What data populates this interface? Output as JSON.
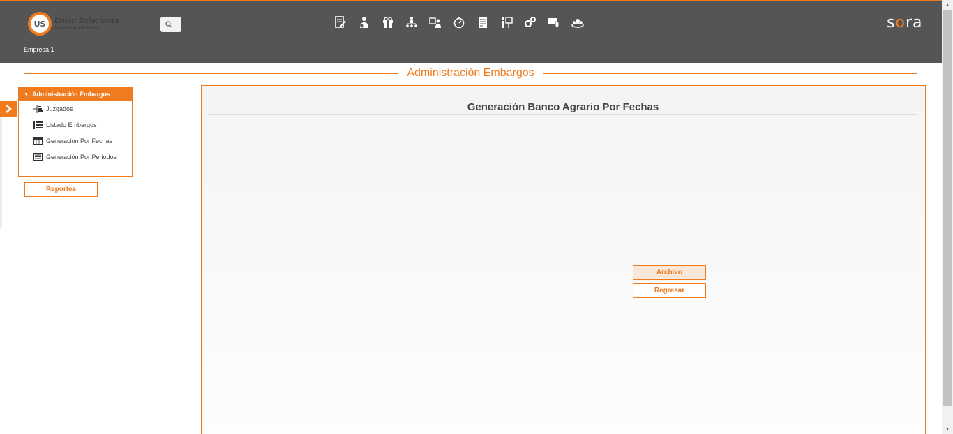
{
  "header": {
    "logo_line1": "Unión Soluciones",
    "logo_line2": "Sistemas de Información",
    "logo_mark": "US",
    "company": "Empresa 1",
    "brand_prefix": "s",
    "brand_o": "o",
    "brand_suffix": "ra",
    "top_icons": [
      "notes-edit-icon",
      "employee-money-icon",
      "gift-icon",
      "hierarchy-icon",
      "staff-exchange-icon",
      "stopwatch-icon",
      "document-list-icon",
      "training-presentation-icon",
      "gears-icon",
      "shield-badge-icon",
      "team-meeting-icon"
    ]
  },
  "page": {
    "title": "Administración Embargos"
  },
  "menu": {
    "header": "Administración Embargos",
    "items": [
      {
        "label": "Juzgados",
        "icon": "court-hierarchy-icon"
      },
      {
        "label": "Listado Embargos",
        "icon": "list-icon"
      },
      {
        "label": "Generacion Por Fechas",
        "icon": "calendar-icon"
      },
      {
        "label": "Generación Por Periodos",
        "icon": "table-icon"
      }
    ],
    "reportes": "Reportes"
  },
  "panel": {
    "title": "Generación Banco Agrario Por Fechas",
    "archivo": "Archivo",
    "regresar": "Regresar"
  },
  "colors": {
    "accent": "#f07a1e",
    "header_bg": "#555555"
  }
}
